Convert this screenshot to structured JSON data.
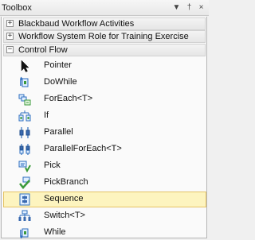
{
  "window": {
    "title": "Toolbox",
    "dropdown_glyph": "▼",
    "pin_glyph": "†",
    "close_glyph": "×"
  },
  "categories": [
    {
      "label": "Blackbaud Workflow Activities",
      "expander": "+",
      "expanded": false
    },
    {
      "label": "Workflow System Role for Training Exercise",
      "expander": "+",
      "expanded": false
    },
    {
      "label": "Control Flow",
      "expander": "−",
      "expanded": true
    }
  ],
  "items": [
    {
      "label": "Pointer",
      "icon": "pointer-icon"
    },
    {
      "label": "DoWhile",
      "icon": "dowhile-icon"
    },
    {
      "label": "ForEach<T>",
      "icon": "foreach-icon"
    },
    {
      "label": "If",
      "icon": "if-icon"
    },
    {
      "label": "Parallel",
      "icon": "parallel-icon"
    },
    {
      "label": "ParallelForEach<T>",
      "icon": "parallelforeach-icon"
    },
    {
      "label": "Pick",
      "icon": "pick-icon"
    },
    {
      "label": "PickBranch",
      "icon": "pickbranch-icon"
    },
    {
      "label": "Sequence",
      "icon": "sequence-icon",
      "selected": true
    },
    {
      "label": "Switch<T>",
      "icon": "switch-icon"
    },
    {
      "label": "While",
      "icon": "while-icon"
    }
  ],
  "colors": {
    "selection_bg": "#fdf4bf",
    "selection_border": "#e5c365",
    "icon_blue": "#2f6fbf",
    "icon_green": "#3a9a3a"
  }
}
